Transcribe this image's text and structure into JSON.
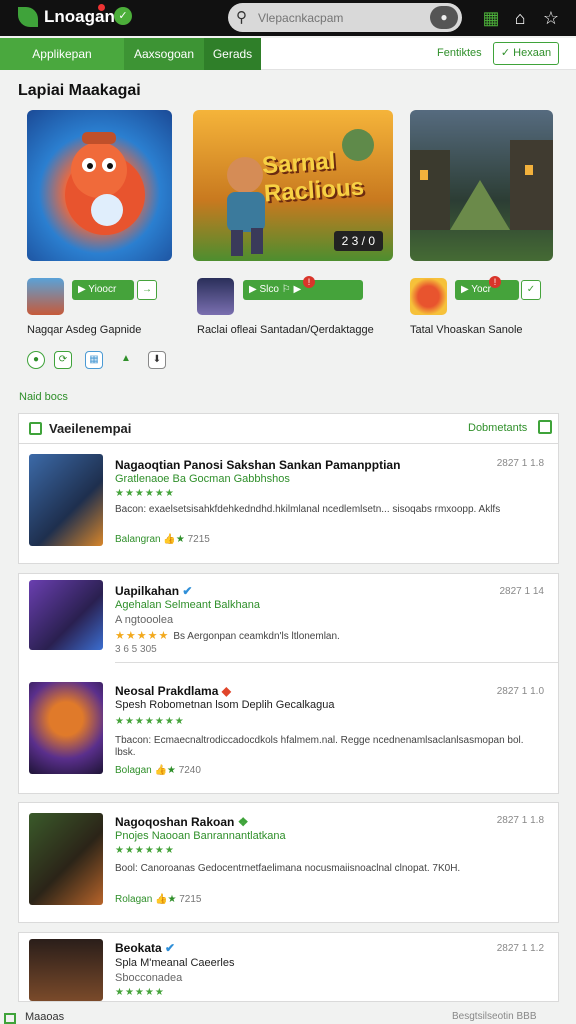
{
  "header": {
    "logo_text": "Lnoagan",
    "search_placeholder": "Vlepacnkacpam",
    "icons": [
      "leaf-logo-icon",
      "search-icon",
      "mic-icon",
      "notification-icon",
      "home-icon",
      "star-icon"
    ]
  },
  "nav": {
    "tabs": [
      "Applikepan",
      "Aaxsogoan",
      "Gerads"
    ],
    "right_link": "Fentiktes",
    "right_button": "Hexaan"
  },
  "featured": {
    "section_title": "Lapiai Maakagai",
    "banner_title": "Sarnal Raclious",
    "banner_badge": "2 3 / 0",
    "items": [
      {
        "caption": "Nagqar Asdeg Gapnide",
        "pill": "Yioocr"
      },
      {
        "caption": "Raclai ofleai Santadan/Qerdaktagge",
        "pill": "Slco"
      },
      {
        "caption": "Tatal Vhoaskan Sanole",
        "pill": "Yocr"
      }
    ]
  },
  "sub_label": "Naid bocs",
  "list": {
    "title": "Vaeilenempai",
    "link": "Dobmetants",
    "items": [
      {
        "name": "Nagaoqtian Panosi Sakshan Sankan Pamanpptian",
        "sub": "Gratlenaoe Ba Gocman Gabbhshos",
        "stars": "★★★★★★",
        "desc": "Bacon: exaelsetsisahkfdehkedndhd.hkilmlanal ncedlemlsetn... sisoqabs rmxoopp. Aklfs",
        "meta": "Balangran",
        "count": "7215",
        "date": "2827 1 1.8"
      },
      {
        "name": "Uapilkahan",
        "sub": "Agehalan Selmeant Balkhana",
        "sub2": "A ngtooolea",
        "stars": "★★★★★",
        "desc": "Bs Aergonpan ceamkdn'ls ltlonemlan.",
        "count": "3 6 5 305",
        "date": "2827 1 14"
      },
      {
        "name": "Neosal Prakdlama",
        "sub": "Spesh Robometnan lsom Deplih Gecalkagua",
        "stars": "★★★★★★★",
        "desc": "Tbacon: Ecmaecnaltrodiccadocdkols hfalmem.nal. Regge ncednenamlsaclanlsasmopan bol. lbsk.",
        "meta": "Bolagan",
        "count": "7240",
        "date": "2827 1 1.0"
      },
      {
        "name": "Nagoqoshan Rakoan",
        "sub": "Pnojes Naooan Banrannantlatkana",
        "stars": "★★★★★★",
        "desc": "Bool: Canoroanas Gedocentrnetfaelimana nocusmaiisnoaclnal clnopat. 7K0H.",
        "meta": "Rolagan",
        "count": "7215",
        "date": "2827 1 1.8"
      },
      {
        "name": "Beokata",
        "sub": "Spla M'meanal Caeerles",
        "sub2": "Sbocconadea",
        "stars": "★★★★★",
        "date": "2827 1 1.2"
      }
    ]
  },
  "footer": {
    "left": "Maaoas",
    "right": "Besgtsilseotin BBB"
  },
  "colors": {
    "brand_green": "#3fa33a",
    "topbar": "#111111"
  }
}
